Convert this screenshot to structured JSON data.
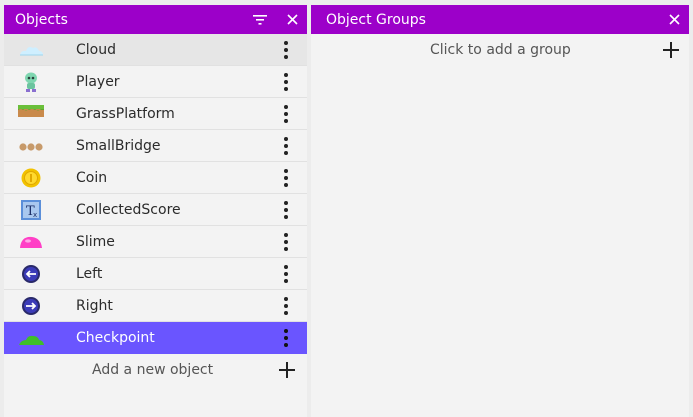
{
  "objects_panel": {
    "title": "Objects",
    "filter_icon": "filter-icon",
    "close_icon": "close-icon",
    "items": [
      {
        "label": "Cloud",
        "icon": "cloud-thumbnail"
      },
      {
        "label": "Player",
        "icon": "player-thumbnail"
      },
      {
        "label": "GrassPlatform",
        "icon": "grass-platform-thumbnail"
      },
      {
        "label": "SmallBridge",
        "icon": "small-bridge-thumbnail"
      },
      {
        "label": "Coin",
        "icon": "coin-thumbnail"
      },
      {
        "label": "CollectedScore",
        "icon": "text-object-thumbnail"
      },
      {
        "label": "Slime",
        "icon": "slime-thumbnail"
      },
      {
        "label": "Left",
        "icon": "left-arrow-thumbnail"
      },
      {
        "label": "Right",
        "icon": "right-arrow-thumbnail"
      },
      {
        "label": "Checkpoint",
        "icon": "checkpoint-thumbnail",
        "selected": true
      }
    ],
    "add_label": "Add a new object"
  },
  "groups_panel": {
    "title": "Object Groups",
    "close_icon": "close-icon",
    "add_label": "Click to add a group"
  },
  "colors": {
    "titlebar": "#9c00c9",
    "selected_row": "#6a55ff"
  }
}
